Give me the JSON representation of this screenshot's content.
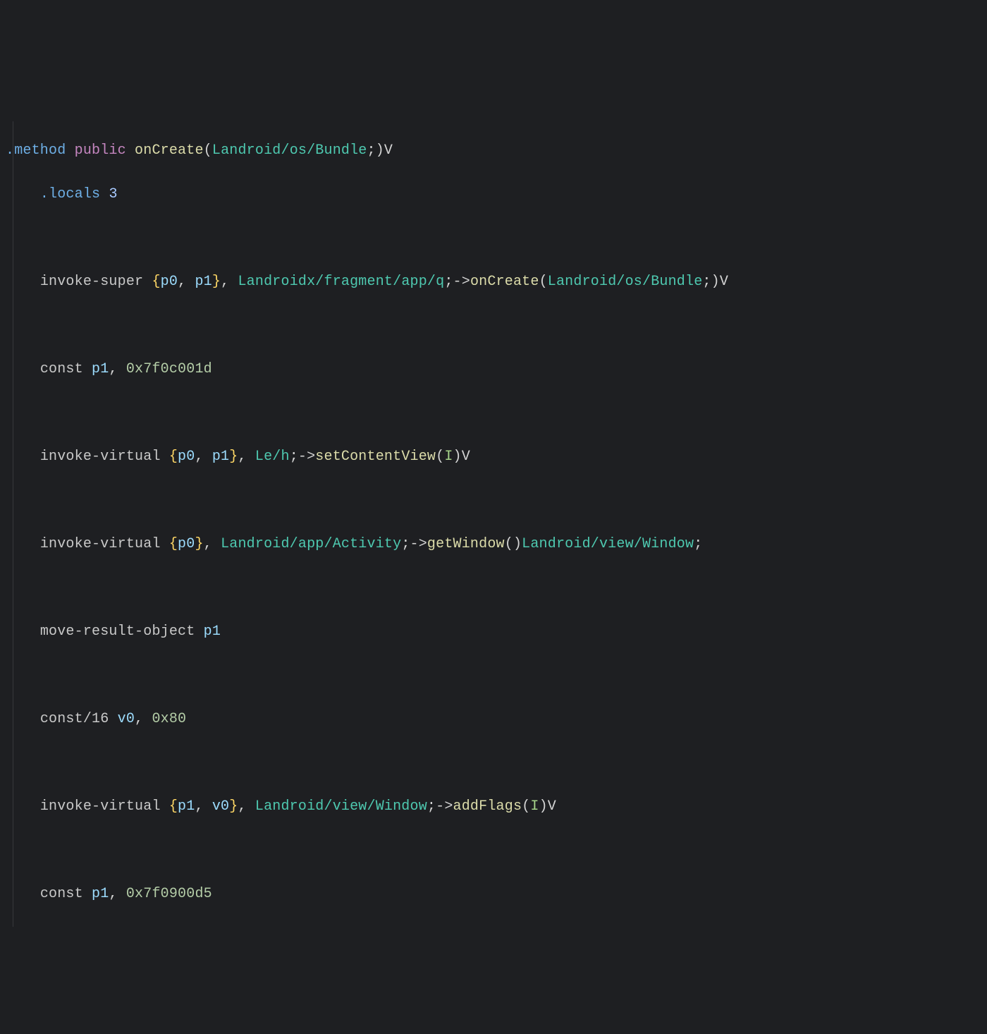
{
  "code": {
    "l1_method": ".method",
    "l1_public": "public",
    "l1_fn": "onCreate",
    "l1_type": "Landroid/os/Bundle",
    "l1_sig_tail": "V",
    "l2_locals": ".locals",
    "l2_num": "3",
    "l4_instr": "invoke-super",
    "l4_reg0": "p0",
    "l4_reg1": "p1",
    "l4_type": "Landroidx/fragment/app/q",
    "l4_arrow": "->",
    "l4_fn": "onCreate",
    "l4_argtype": "Landroid/os/Bundle",
    "l4_sig_tail": "V",
    "l6_instr": "const",
    "l6_reg": "p1",
    "l6_val": "0x7f0c001d",
    "l8_instr": "invoke-virtual",
    "l8_reg0": "p0",
    "l8_reg1": "p1",
    "l8_type": "Le/h",
    "l8_arrow": "->",
    "l8_fn": "setContentView",
    "l8_argI": "I",
    "l8_sig_tail": "V",
    "l10_instr": "invoke-virtual",
    "l10_reg0": "p0",
    "l10_type": "Landroid/app/Activity",
    "l10_arrow": "->",
    "l10_fn": "getWindow",
    "l10_ret": "Landroid/view/Window",
    "l12_instr": "move-result-object",
    "l12_reg": "p1",
    "l14_instr": "const/16",
    "l14_reg": "v0",
    "l14_val": "0x80",
    "l16_instr": "invoke-virtual",
    "l16_reg0": "p1",
    "l16_reg1": "v0",
    "l16_type": "Landroid/view/Window",
    "l16_arrow": "->",
    "l16_fn": "addFlags",
    "l16_argI": "I",
    "l16_sig_tail": "V",
    "l18_instr": "const",
    "l18_reg": "p1",
    "l18_val": "0x7f0900d5"
  }
}
